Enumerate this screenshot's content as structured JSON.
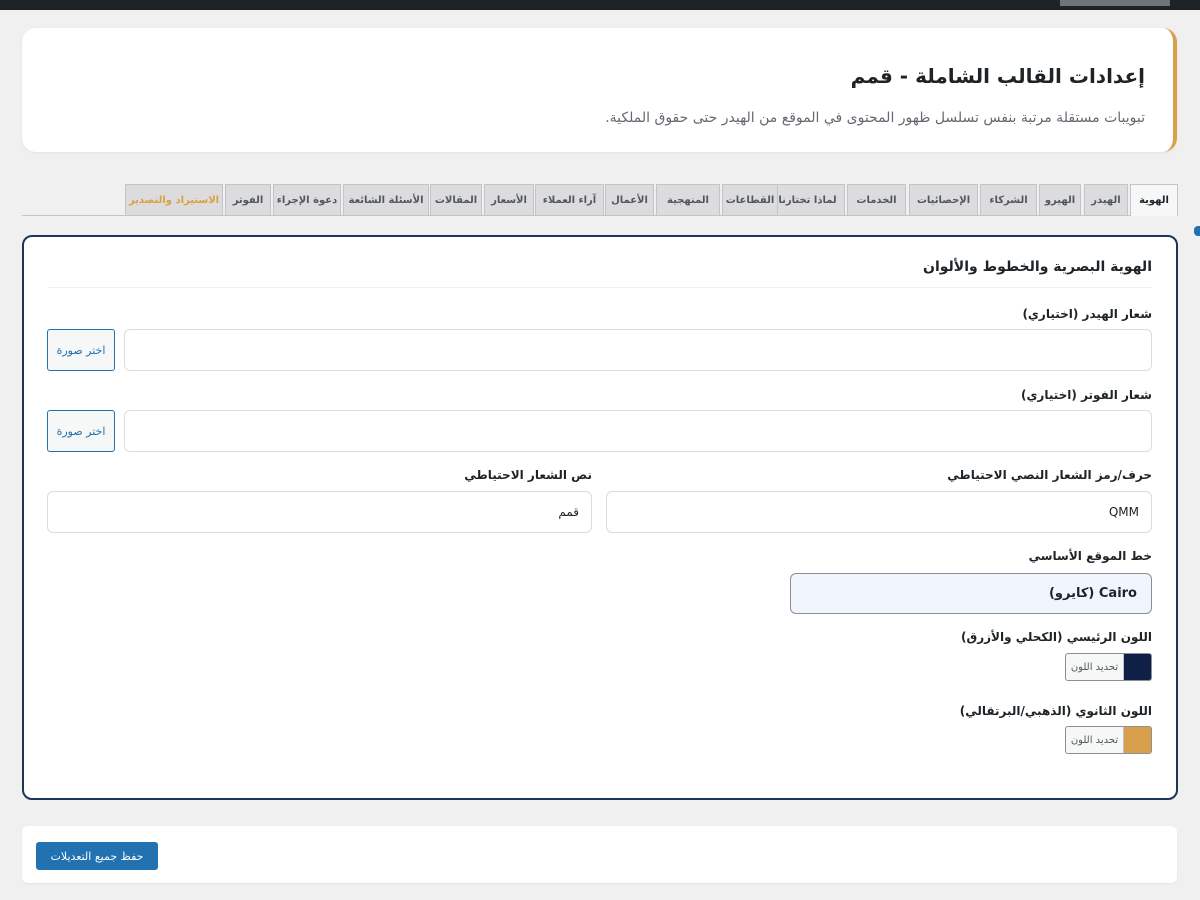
{
  "colors": {
    "accent_blue": "#2271b1",
    "header_border": "#d9a04a",
    "main_border": "#1d3557",
    "primary_color": "#0f1f45",
    "secondary_color": "#d8a04c",
    "export_tab_text": "#dba040"
  },
  "header": {
    "title": "إعدادات القالب الشاملة - قمم",
    "subtitle": "تبويبات مستقلة مرتبة بنفس تسلسل ظهور المحتوى في الموقع من الهيدر حتى حقوق الملكية."
  },
  "tabs": [
    {
      "label": "الهوية",
      "active": true
    },
    {
      "label": "الهيدر",
      "active": false
    },
    {
      "label": "الهيرو",
      "active": false
    },
    {
      "label": "الشركاء",
      "active": false
    },
    {
      "label": "الإحصائيات",
      "active": false
    },
    {
      "label": "الخدمات",
      "active": false
    },
    {
      "label": "لماذا تختارنا",
      "active": false
    },
    {
      "label": "القطاعات",
      "active": false
    },
    {
      "label": "المنهجية",
      "active": false
    },
    {
      "label": "الأعمال",
      "active": false
    },
    {
      "label": "آراء العملاء",
      "active": false
    },
    {
      "label": "الأسعار",
      "active": false
    },
    {
      "label": "المقالات",
      "active": false
    },
    {
      "label": "الأسئلة الشائعة",
      "active": false
    },
    {
      "label": "دعوة الإجراء",
      "active": false
    },
    {
      "label": "الفوتر",
      "active": false
    },
    {
      "label": "الاستيراد والتصدير",
      "active": false
    }
  ],
  "identity": {
    "section_title": "الهوية البصرية والخطوط والألوان",
    "header_logo_label": "شعار الهيدر (اختياري)",
    "header_logo_value": "",
    "footer_logo_label": "شعار الفوتر (اختياري)",
    "footer_logo_value": "",
    "choose_image_label": "اختر صورة",
    "fallback_char_label": "حرف/رمز الشعار النصي الاحتياطي",
    "fallback_char_value": "QMM",
    "fallback_text_label": "نص الشعار الاحتياطي",
    "fallback_text_value": "قمم",
    "font_label": "خط الموقع الأساسي",
    "font_value": "Cairo (كايرو)",
    "primary_color_label": "اللون الرئيسي (الكحلي والأزرق)",
    "secondary_color_label": "اللون الثانوي (الذهبي/البرتقالي)",
    "select_color_label": "تحديد اللون"
  },
  "footer": {
    "save_label": "حفظ جميع التعديلات"
  }
}
